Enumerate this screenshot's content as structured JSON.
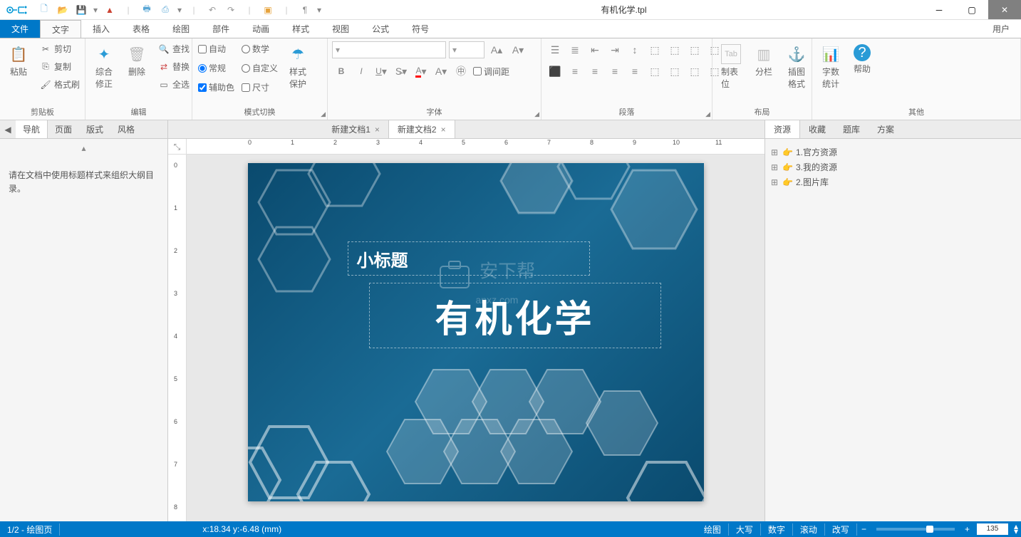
{
  "window": {
    "title": "有机化学.tpl"
  },
  "menus": {
    "file": "文件",
    "text": "文字",
    "insert": "插入",
    "table": "表格",
    "draw": "绘图",
    "component": "部件",
    "animation": "动画",
    "style": "样式",
    "view": "视图",
    "formula": "公式",
    "symbol": "符号",
    "user": "用户"
  },
  "ribbon": {
    "clipboard": {
      "title": "剪贴板",
      "paste": "粘贴",
      "cut": "剪切",
      "copy": "复制",
      "brush": "格式刷"
    },
    "edit": {
      "title": "编辑",
      "combine": "综合\n修正",
      "delete": "删除",
      "find": "查找",
      "replace": "替换",
      "selectall": "全选"
    },
    "mode": {
      "title": "模式切换",
      "auto": "自动",
      "normal": "常规",
      "helper": "辅助色",
      "math": "数学",
      "custom": "自定义",
      "ruler": "尺寸",
      "protect": "样式\n保护"
    },
    "font": {
      "title": "字体",
      "spacing": "调间距"
    },
    "paragraph": {
      "title": "段落"
    },
    "layout": {
      "title": "布局",
      "tab": "制表位",
      "column": "分栏",
      "frame": "插图\n格式"
    },
    "other": {
      "title": "其他",
      "wordcount": "字数\n统计",
      "help": "帮助"
    }
  },
  "leftpanel": {
    "tabs": {
      "nav": "导航",
      "page": "页面",
      "layout": "版式",
      "style": "风格"
    },
    "hint": "请在文档中使用标题样式来组织大纲目录。"
  },
  "doctabs": {
    "doc1": "新建文档1",
    "doc2": "新建文档2"
  },
  "rightpanel": {
    "tabs": {
      "resource": "资源",
      "favorite": "收藏",
      "question": "题库",
      "plan": "方案"
    },
    "tree": [
      {
        "label": "1.官方资源"
      },
      {
        "label": "3.我的资源"
      },
      {
        "label": "2.图片库"
      }
    ]
  },
  "slide": {
    "subtitle": "小标题",
    "title": "有机化学",
    "watermark": "安下帮\nanxz.com"
  },
  "ruler": {
    "marks": [
      "0",
      "1",
      "2",
      "3",
      "4",
      "5",
      "6",
      "7",
      "8",
      "9",
      "10",
      "11"
    ]
  },
  "status": {
    "page": "1/2 - 绘图页",
    "coord": "x:18.34  y:-6.48  (mm)",
    "draw": "绘图",
    "caps": "大写",
    "num": "数字",
    "scroll": "滚动",
    "ovr": "改写",
    "zoom": "135"
  }
}
